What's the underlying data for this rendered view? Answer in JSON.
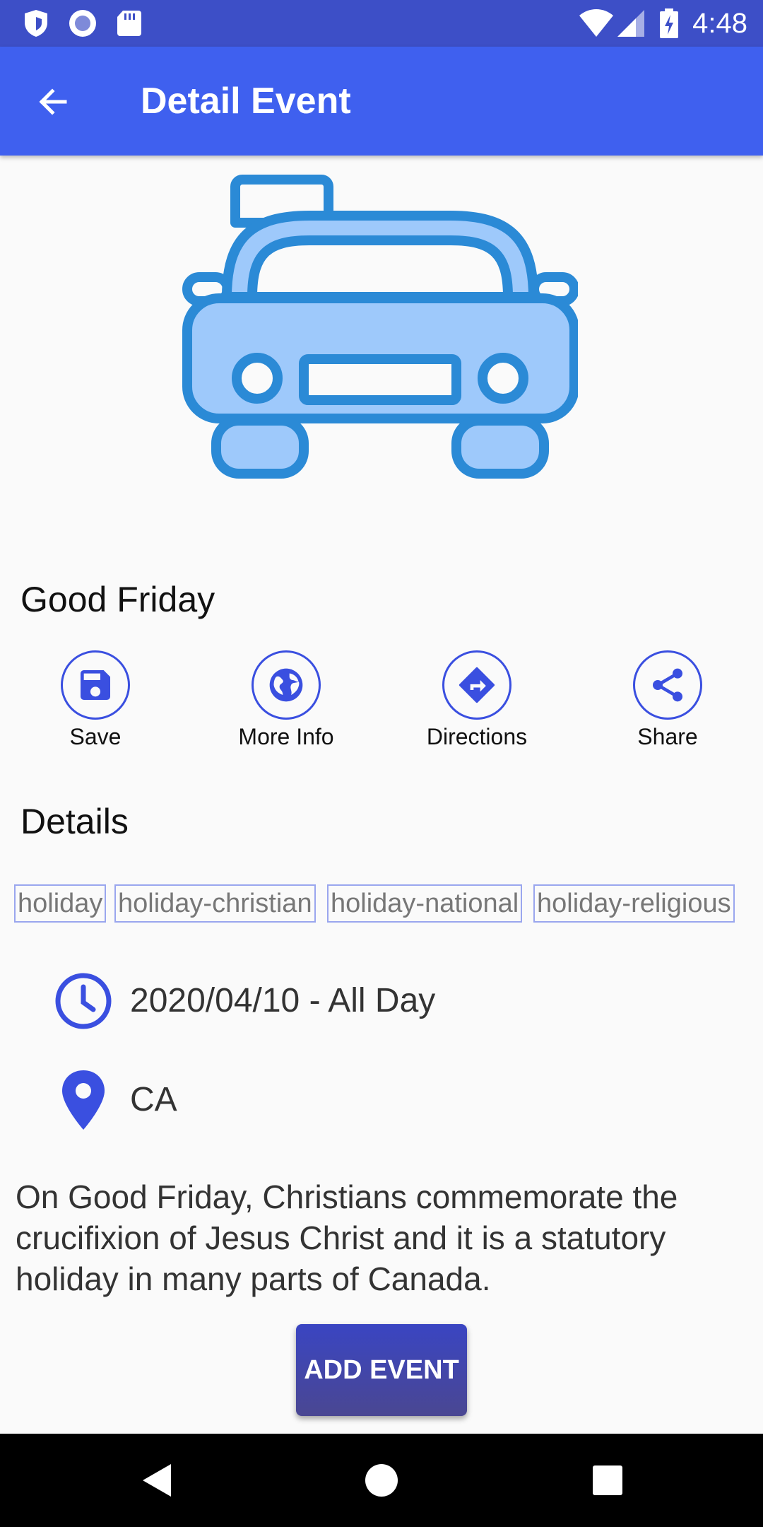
{
  "status_bar": {
    "time": "4:48",
    "icons": [
      "shield-icon",
      "record-icon",
      "sd-card-icon",
      "wifi-icon",
      "signal-icon",
      "battery-charging-icon"
    ]
  },
  "app_bar": {
    "title": "Detail Event",
    "back_icon": "arrow-back-icon"
  },
  "hero": {
    "icon": "car-icon",
    "stroke": "#2b8ad6",
    "fill": "#9ec9fb"
  },
  "event": {
    "title": "Good Friday"
  },
  "actions": [
    {
      "label": "Save",
      "icon": "save-icon"
    },
    {
      "label": "More Info",
      "icon": "globe-icon"
    },
    {
      "label": "Directions",
      "icon": "directions-icon"
    },
    {
      "label": "Share",
      "icon": "share-icon"
    }
  ],
  "details": {
    "heading": "Details",
    "tags": [
      "holiday",
      "holiday-christian",
      "holiday-national",
      "holiday-religious"
    ],
    "date": "2020/04/10 - All Day",
    "location": "CA",
    "description": "On Good Friday, Christians commemorate the crucifixion of Jesus Christ and it is a statutory holiday in many parts of Canada."
  },
  "add_button": {
    "label": "ADD EVENT"
  },
  "colors": {
    "status_bar": "#3d4fc7",
    "app_bar": "#3f60ef",
    "accent": "#3a4fe0",
    "tag_border": "#9aa6ee"
  },
  "nav_bar": {
    "icons": [
      "back-triangle-icon",
      "home-circle-icon",
      "recents-square-icon"
    ]
  }
}
